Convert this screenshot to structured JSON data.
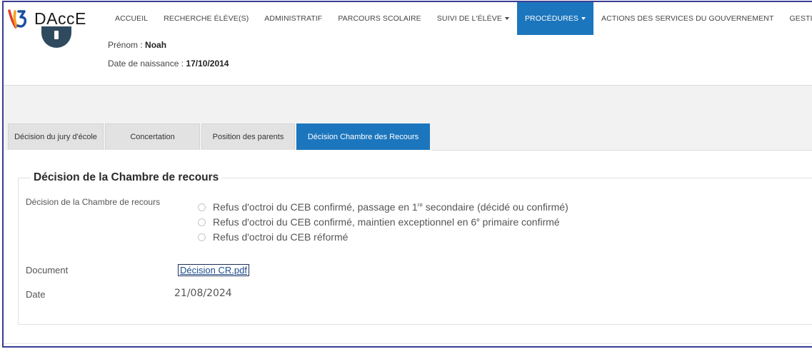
{
  "app": {
    "name": "DAccE"
  },
  "nav": [
    {
      "label": "ACCUEIL",
      "dropdown": false,
      "active": false
    },
    {
      "label": "RECHERCHE ÉLÈVE(S)",
      "dropdown": false,
      "active": false
    },
    {
      "label": "ADMINISTRATIF",
      "dropdown": false,
      "active": false
    },
    {
      "label": "PARCOURS SCOLAIRE",
      "dropdown": false,
      "active": false
    },
    {
      "label": "SUIVI DE L'ÉLÈVE",
      "dropdown": true,
      "active": false
    },
    {
      "label": "PROCÉDURES",
      "dropdown": true,
      "active": true
    },
    {
      "label": "ACTIONS DES SERVICES DU GOUVERNEMENT",
      "dropdown": false,
      "active": false
    },
    {
      "label": "GESTION",
      "dropdown": true,
      "active": false
    }
  ],
  "student": {
    "first_name_label": "Prénom :",
    "first_name": "Noah",
    "birth_label": "Date de naissance :",
    "birth_date": "17/10/2014"
  },
  "tabs": [
    {
      "label": "Décision du jury d'école"
    },
    {
      "label": "Concertation"
    },
    {
      "label": "Position des parents"
    },
    {
      "label": "Décision Chambre des Recours"
    }
  ],
  "section": {
    "title": "Décision de la Chambre de recours",
    "decision_label": "Décision de la Chambre de recours",
    "options": [
      {
        "pre": "Refus d'octroi du CEB confirmé, passage en 1",
        "sup": "re",
        "post": " secondaire (décidé ou confirmé)"
      },
      {
        "pre": "Refus d'octroi du CEB confirmé, maintien exceptionnel en 6",
        "sup": "e",
        "post": " primaire confirmé"
      },
      {
        "pre": "Refus d'octroi du CEB réformé",
        "sup": "",
        "post": ""
      }
    ],
    "document_label": "Document",
    "document_file": "Décision CR.pdf",
    "date_label": "Date",
    "date_value": "21/08/2024"
  },
  "colors": {
    "accent": "#1c76bd",
    "frame": "#3c3c94"
  }
}
